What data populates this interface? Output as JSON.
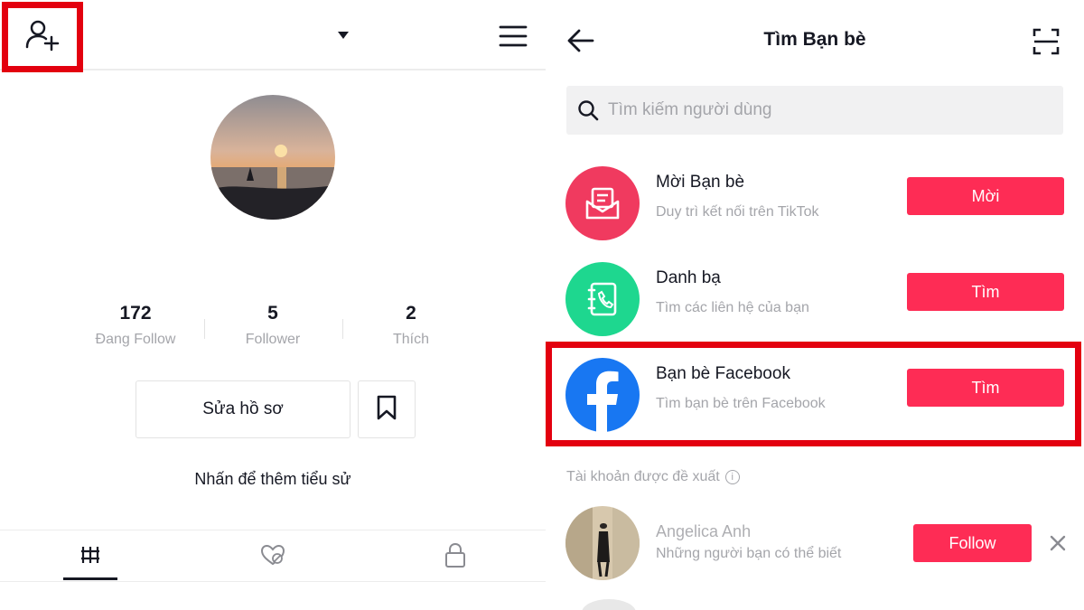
{
  "profile": {
    "stats": [
      {
        "value": "172",
        "label": "Đang Follow"
      },
      {
        "value": "5",
        "label": "Follower"
      },
      {
        "value": "2",
        "label": "Thích"
      }
    ],
    "edit_button": "Sửa hồ sơ",
    "bio_prompt": "Nhấn để thêm tiểu sử",
    "tabs": [
      "videos-grid-icon",
      "liked-videos-icon",
      "private-lock-icon"
    ],
    "icons": {
      "add_user": "person-plus-icon",
      "dropdown": "caret-down-icon",
      "menu": "hamburger-icon",
      "bookmark": "bookmark-icon"
    }
  },
  "find_friends": {
    "title": "Tìm Bạn bè",
    "search": {
      "placeholder": "Tìm kiếm người dùng"
    },
    "rows": [
      {
        "title": "Mời Bạn bè",
        "subtitle": "Duy trì kết nối trên TikTok",
        "button": "Mời",
        "icon": "invite-envelope-icon",
        "icon_color": "#f03a5f"
      },
      {
        "title": "Danh bạ",
        "subtitle": "Tìm các liên hệ của bạn",
        "button": "Tìm",
        "icon": "contacts-book-icon",
        "icon_color": "#1ed78f"
      },
      {
        "title": "Bạn bè Facebook",
        "subtitle": "Tìm bạn bè trên Facebook",
        "button": "Tìm",
        "icon": "facebook-icon",
        "icon_color": "#1877f2"
      }
    ],
    "suggested_label": "Tài khoản được đề xuất",
    "suggested": [
      {
        "name": "Angelica Anh",
        "subtitle": "Những người bạn có thể biết",
        "button": "Follow"
      }
    ]
  },
  "colors": {
    "accent": "#fe2c55",
    "highlight": "#e3000f",
    "muted_text": "#a4a5aa"
  }
}
